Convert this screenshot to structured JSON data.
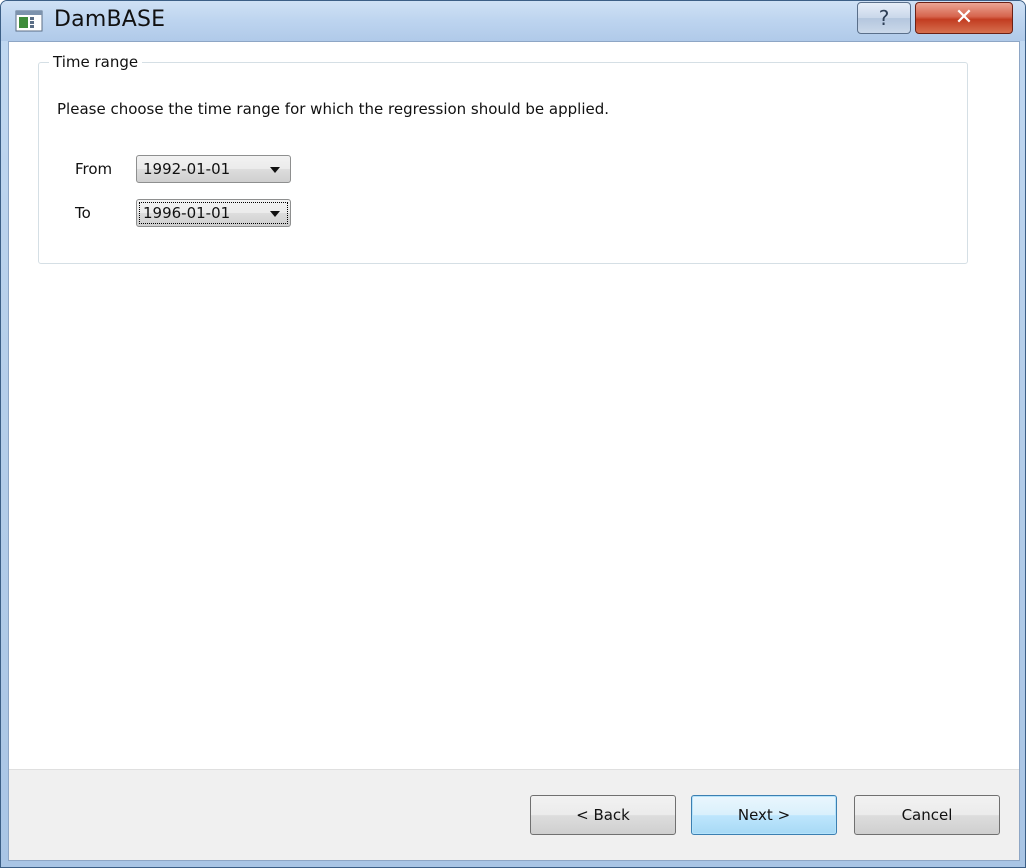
{
  "window": {
    "title": "DamBASE",
    "help_label": "?",
    "close_label": "✕"
  },
  "group": {
    "legend": "Time range",
    "instruction": "Please choose the time range for which the regression should be applied."
  },
  "from": {
    "label": "From",
    "value": "1992-01-01"
  },
  "to": {
    "label": "To",
    "value": "1996-01-01"
  },
  "footer": {
    "back_label": "< Back",
    "next_label": "Next >",
    "cancel_label": "Cancel"
  },
  "icons": {
    "app": "app-window-icon",
    "dropdown": "chevron-down-icon"
  }
}
